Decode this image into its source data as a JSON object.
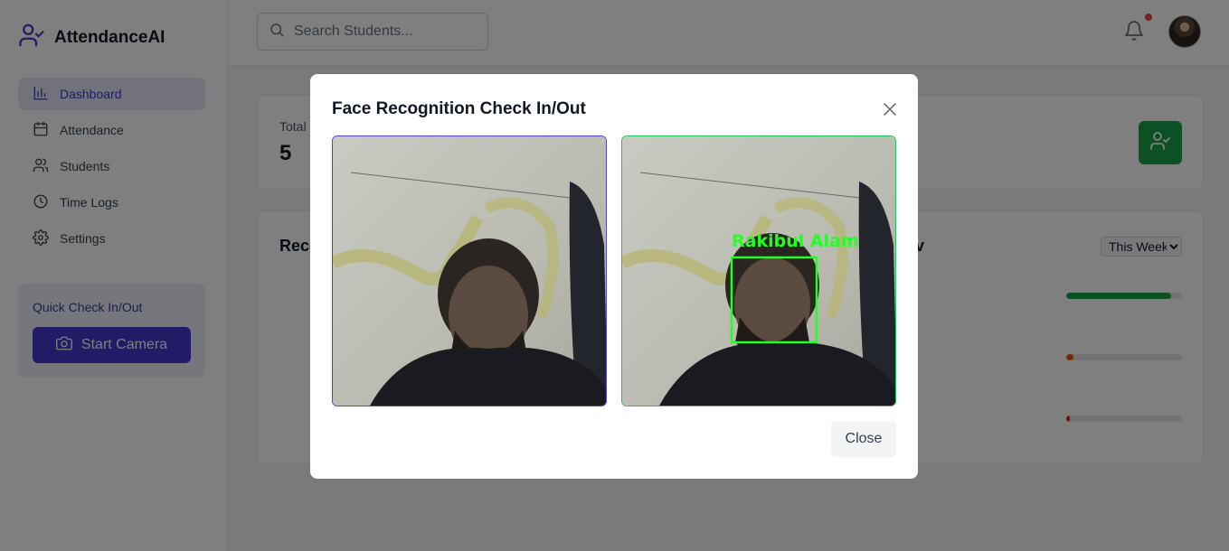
{
  "app": {
    "title": "AttendanceAI"
  },
  "sidebar": {
    "items": [
      {
        "label": "Dashboard",
        "icon": "bar-chart-icon",
        "active": true
      },
      {
        "label": "Attendance",
        "icon": "calendar-icon",
        "active": false
      },
      {
        "label": "Students",
        "icon": "users-icon",
        "active": false
      },
      {
        "label": "Time Logs",
        "icon": "clock-icon",
        "active": false
      },
      {
        "label": "Settings",
        "icon": "gear-icon",
        "active": false
      }
    ],
    "quick_check": {
      "title": "Quick Check In/Out",
      "button_label": "Start Camera"
    }
  },
  "header": {
    "search_placeholder": "Search Students..."
  },
  "dashboard": {
    "stat_label": "Total",
    "stat_value": "5",
    "recent_title": "Rece",
    "overview_title": "v",
    "period_select": "This Week",
    "progress": [
      {
        "fraction": 0.91,
        "color": "#16a34a"
      },
      {
        "fraction": 0.06,
        "color": "#ea580c"
      },
      {
        "fraction": 0.03,
        "color": "#dc2626"
      }
    ]
  },
  "modal": {
    "title": "Face Recognition Check In/Out",
    "recognized_name": "Rakibul Alam",
    "close_label": "Close"
  },
  "colors": {
    "accent": "#4338ca",
    "success": "#16a34a",
    "detection": "#22ff22"
  }
}
